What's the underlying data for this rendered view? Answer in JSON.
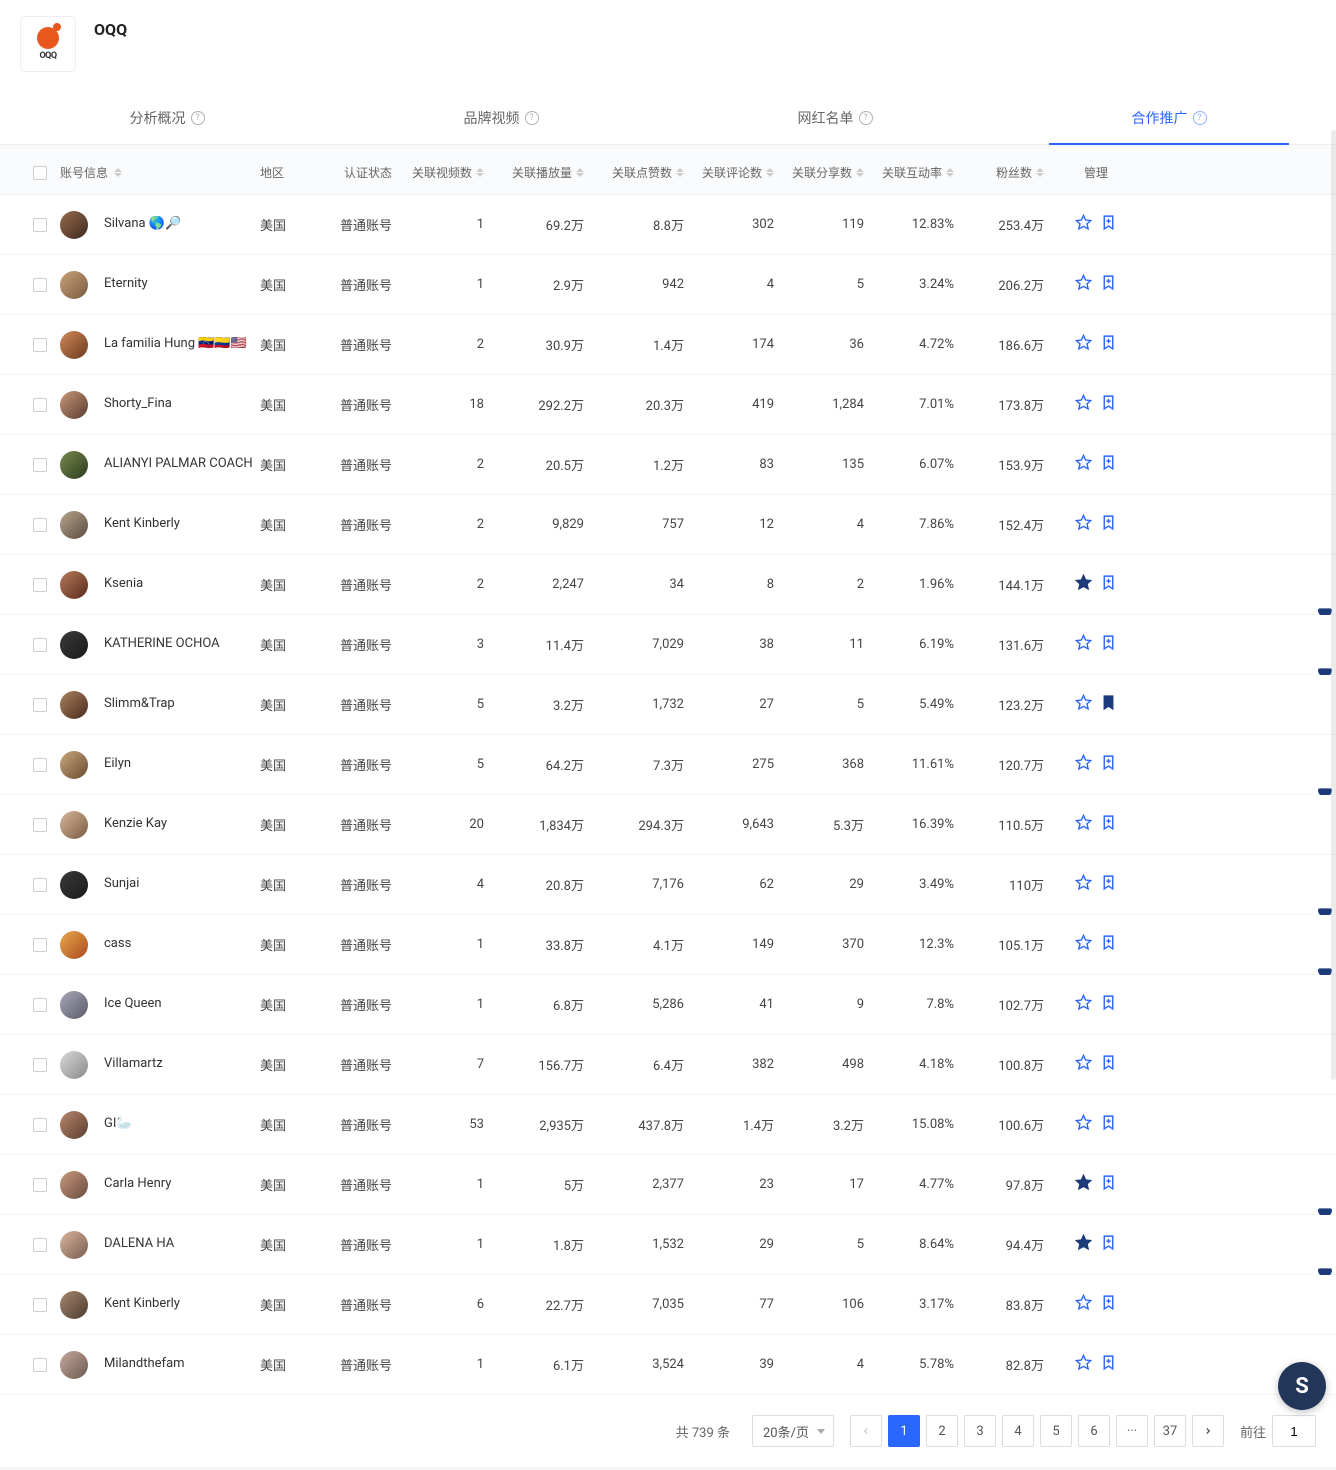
{
  "header": {
    "brand": "OQQ",
    "logo_text": "OQQ"
  },
  "tabs": [
    {
      "label": "分析概况"
    },
    {
      "label": "品牌视频"
    },
    {
      "label": "网红名单"
    },
    {
      "label": "合作推广"
    }
  ],
  "table": {
    "columns": {
      "account": "账号信息",
      "region": "地区",
      "auth": "认证状态",
      "videos": "关联视频数",
      "plays": "关联播放量",
      "likes": "关联点赞数",
      "comments": "关联评论数",
      "shares": "关联分享数",
      "engage": "关联互动率",
      "fans": "粉丝数",
      "mgmt": "管理"
    },
    "rows": [
      {
        "name": "Silvana 🌎🔎",
        "region": "美国",
        "auth": "普通账号",
        "videos": "1",
        "plays": "69.2万",
        "likes": "8.8万",
        "comments": "302",
        "shares": "119",
        "engage": "12.83%",
        "fans": "253.4万",
        "av": "linear-gradient(135deg,#9a6a4e,#3a2a1e)",
        "star": false,
        "bm": false,
        "tail": 0
      },
      {
        "name": "Eternity",
        "region": "美国",
        "auth": "普通账号",
        "videos": "1",
        "plays": "2.9万",
        "likes": "942",
        "comments": "4",
        "shares": "5",
        "engage": "3.24%",
        "fans": "206.2万",
        "av": "linear-gradient(135deg,#caa27b,#7a5a3e)",
        "star": false,
        "bm": false,
        "tail": 0
      },
      {
        "name": "La familia Hung 🇻🇪🇨🇴🇺🇸",
        "region": "美国",
        "auth": "普通账号",
        "videos": "2",
        "plays": "30.9万",
        "likes": "1.4万",
        "comments": "174",
        "shares": "36",
        "engage": "4.72%",
        "fans": "186.6万",
        "av": "linear-gradient(135deg,#d28a58,#6a3a1e)",
        "star": false,
        "bm": false,
        "tail": 0
      },
      {
        "name": "Shorty_Fina",
        "region": "美国",
        "auth": "普通账号",
        "videos": "18",
        "plays": "292.2万",
        "likes": "20.3万",
        "comments": "419",
        "shares": "1,284",
        "engage": "7.01%",
        "fans": "173.8万",
        "av": "linear-gradient(135deg,#c79a7a,#5a3a2e)",
        "star": false,
        "bm": false,
        "tail": 0
      },
      {
        "name": "ALIANYI PALMAR COACH",
        "region": "美国",
        "auth": "普通账号",
        "videos": "2",
        "plays": "20.5万",
        "likes": "1.2万",
        "comments": "83",
        "shares": "135",
        "engage": "6.07%",
        "fans": "153.9万",
        "av": "linear-gradient(135deg,#7a8a4e,#2a3a1e)",
        "star": false,
        "bm": false,
        "tail": 0
      },
      {
        "name": "Kent Kinberly",
        "region": "美国",
        "auth": "普通账号",
        "videos": "2",
        "plays": "9,829",
        "likes": "757",
        "comments": "12",
        "shares": "4",
        "engage": "7.86%",
        "fans": "152.4万",
        "av": "linear-gradient(135deg,#baa68e,#5a4a3e)",
        "star": false,
        "bm": false,
        "tail": 0
      },
      {
        "name": "Ksenia",
        "region": "美国",
        "auth": "普通账号",
        "videos": "2",
        "plays": "2,247",
        "likes": "34",
        "comments": "8",
        "shares": "2",
        "engage": "1.96%",
        "fans": "144.1万",
        "av": "linear-gradient(135deg,#b57a5a,#5a2a1e)",
        "star": true,
        "bm": false,
        "tail": 1
      },
      {
        "name": "KATHERINE OCHOA",
        "region": "美国",
        "auth": "普通账号",
        "videos": "3",
        "plays": "11.4万",
        "likes": "7,029",
        "comments": "38",
        "shares": "11",
        "engage": "6.19%",
        "fans": "131.6万",
        "av": "linear-gradient(135deg,#3a3a3a,#1a1a1a)",
        "star": false,
        "bm": false,
        "tail": 1
      },
      {
        "name": "Slimm&Trap",
        "region": "美国",
        "auth": "普通账号",
        "videos": "5",
        "plays": "3.2万",
        "likes": "1,732",
        "comments": "27",
        "shares": "5",
        "engage": "5.49%",
        "fans": "123.2万",
        "av": "linear-gradient(135deg,#a8825e,#4a2a1e)",
        "star": false,
        "bm": true,
        "tail": 0
      },
      {
        "name": "Eilyn",
        "region": "美国",
        "auth": "普通账号",
        "videos": "5",
        "plays": "64.2万",
        "likes": "7.3万",
        "comments": "275",
        "shares": "368",
        "engage": "11.61%",
        "fans": "120.7万",
        "av": "linear-gradient(135deg,#c8a87e,#6a4a2e)",
        "star": false,
        "bm": false,
        "tail": 1
      },
      {
        "name": "Kenzie Kay",
        "region": "美国",
        "auth": "普通账号",
        "videos": "20",
        "plays": "1,834万",
        "likes": "294.3万",
        "comments": "9,643",
        "shares": "5.3万",
        "engage": "16.39%",
        "fans": "110.5万",
        "av": "linear-gradient(135deg,#d8b89e,#7a5a3e)",
        "star": false,
        "bm": false,
        "tail": 0
      },
      {
        "name": "Sunjai",
        "region": "美国",
        "auth": "普通账号",
        "videos": "4",
        "plays": "20.8万",
        "likes": "7,176",
        "comments": "62",
        "shares": "29",
        "engage": "3.49%",
        "fans": "110万",
        "av": "linear-gradient(135deg,#3a3a3a,#1a1a1a)",
        "star": false,
        "bm": false,
        "tail": 1
      },
      {
        "name": "cass",
        "region": "美国",
        "auth": "普通账号",
        "videos": "1",
        "plays": "33.8万",
        "likes": "4.1万",
        "comments": "149",
        "shares": "370",
        "engage": "12.3%",
        "fans": "105.1万",
        "av": "linear-gradient(135deg,#e8a84e,#aa4a1e)",
        "star": false,
        "bm": false,
        "tail": 1
      },
      {
        "name": "Ice Queen",
        "region": "美国",
        "auth": "普通账号",
        "videos": "1",
        "plays": "6.8万",
        "likes": "5,286",
        "comments": "41",
        "shares": "9",
        "engage": "7.8%",
        "fans": "102.7万",
        "av": "linear-gradient(135deg,#a8a8b8,#5a5a6a)",
        "star": false,
        "bm": false,
        "tail": 0
      },
      {
        "name": "Villamartz",
        "region": "美国",
        "auth": "普通账号",
        "videos": "7",
        "plays": "156.7万",
        "likes": "6.4万",
        "comments": "382",
        "shares": "498",
        "engage": "4.18%",
        "fans": "100.8万",
        "av": "linear-gradient(135deg,#d8d8d8,#8a8a8a)",
        "star": false,
        "bm": false,
        "tail": 0
      },
      {
        "name": "GI🦢",
        "region": "美国",
        "auth": "普通账号",
        "videos": "53",
        "plays": "2,935万",
        "likes": "437.8万",
        "comments": "1.4万",
        "shares": "3.2万",
        "engage": "15.08%",
        "fans": "100.6万",
        "av": "linear-gradient(135deg,#b88a6e,#5a3a2e)",
        "star": false,
        "bm": false,
        "tail": 0
      },
      {
        "name": "Carla Henry",
        "region": "美国",
        "auth": "普通账号",
        "videos": "1",
        "plays": "5万",
        "likes": "2,377",
        "comments": "23",
        "shares": "17",
        "engage": "4.77%",
        "fans": "97.8万",
        "av": "linear-gradient(135deg,#c89a7e,#6a4a3e)",
        "star": true,
        "bm": false,
        "tail": 1
      },
      {
        "name": "DALENA HA",
        "region": "美国",
        "auth": "普通账号",
        "videos": "1",
        "plays": "1.8万",
        "likes": "1,532",
        "comments": "29",
        "shares": "5",
        "engage": "8.64%",
        "fans": "94.4万",
        "av": "linear-gradient(135deg,#d8b89e,#7a5a4e)",
        "star": true,
        "bm": false,
        "tail": 1
      },
      {
        "name": "Kent Kinberly",
        "region": "美国",
        "auth": "普通账号",
        "videos": "6",
        "plays": "22.7万",
        "likes": "7,035",
        "comments": "77",
        "shares": "106",
        "engage": "3.17%",
        "fans": "83.8万",
        "av": "linear-gradient(135deg,#a8886e,#4a3a2e)",
        "star": false,
        "bm": false,
        "tail": 0
      },
      {
        "name": "Milandthefam",
        "region": "美国",
        "auth": "普通账号",
        "videos": "1",
        "plays": "6.1万",
        "likes": "3,524",
        "comments": "39",
        "shares": "4",
        "engage": "5.78%",
        "fans": "82.8万",
        "av": "linear-gradient(135deg,#c8a89e,#6a5a4e)",
        "star": false,
        "bm": false,
        "tail": 0
      }
    ]
  },
  "footer": {
    "total": "共 739 条",
    "page_size": "20条/页",
    "pages": [
      "1",
      "2",
      "3",
      "4",
      "5",
      "6",
      "···",
      "37"
    ],
    "jump_label": "前往",
    "jump_value": "1"
  },
  "fab": "S"
}
